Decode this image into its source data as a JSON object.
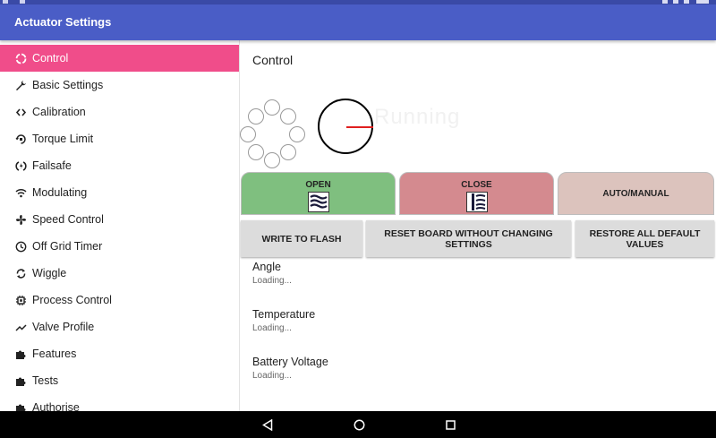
{
  "app": {
    "title": "Actuator Settings"
  },
  "sidebar": {
    "items": [
      {
        "label": "Control",
        "icon": "sync-icon",
        "active": true
      },
      {
        "label": "Basic Settings",
        "icon": "wrench-icon"
      },
      {
        "label": "Calibration",
        "icon": "code-brackets-icon"
      },
      {
        "label": "Torque Limit",
        "icon": "rotate-icon"
      },
      {
        "label": "Failsafe",
        "icon": "failsafe-icon"
      },
      {
        "label": "Modulating",
        "icon": "wifi-icon"
      },
      {
        "label": "Speed Control",
        "icon": "fan-icon"
      },
      {
        "label": "Off Grid Timer",
        "icon": "clock-icon"
      },
      {
        "label": "Wiggle",
        "icon": "refresh-icon"
      },
      {
        "label": "Process Control",
        "icon": "chip-icon"
      },
      {
        "label": "Valve Profile",
        "icon": "trend-icon"
      },
      {
        "label": "Features",
        "icon": "puzzle-icon"
      },
      {
        "label": "Tests",
        "icon": "puzzle-icon"
      },
      {
        "label": "Authorise",
        "icon": "puzzle-icon"
      }
    ]
  },
  "main": {
    "title": "Control",
    "watermark": "Running",
    "control_buttons": {
      "open": "OPEN",
      "close": "CLOSE",
      "auto_manual": "AUTO/MANUAL"
    },
    "action_buttons": {
      "write_flash": "WRITE TO FLASH",
      "reset_board": "RESET BOARD WITHOUT CHANGING SETTINGS",
      "restore_defaults": "RESTORE ALL DEFAULT VALUES"
    },
    "fields": [
      {
        "label": "Angle",
        "value": "Loading..."
      },
      {
        "label": "Temperature",
        "value": "Loading..."
      },
      {
        "label": "Battery Voltage",
        "value": "Loading..."
      }
    ]
  },
  "colors": {
    "appbar": "#4a5dc6",
    "active_item": "#f04d8a",
    "open_button": "#7fbf7f",
    "close_button": "#d48a8f",
    "auto_button": "#dcc3bd"
  }
}
